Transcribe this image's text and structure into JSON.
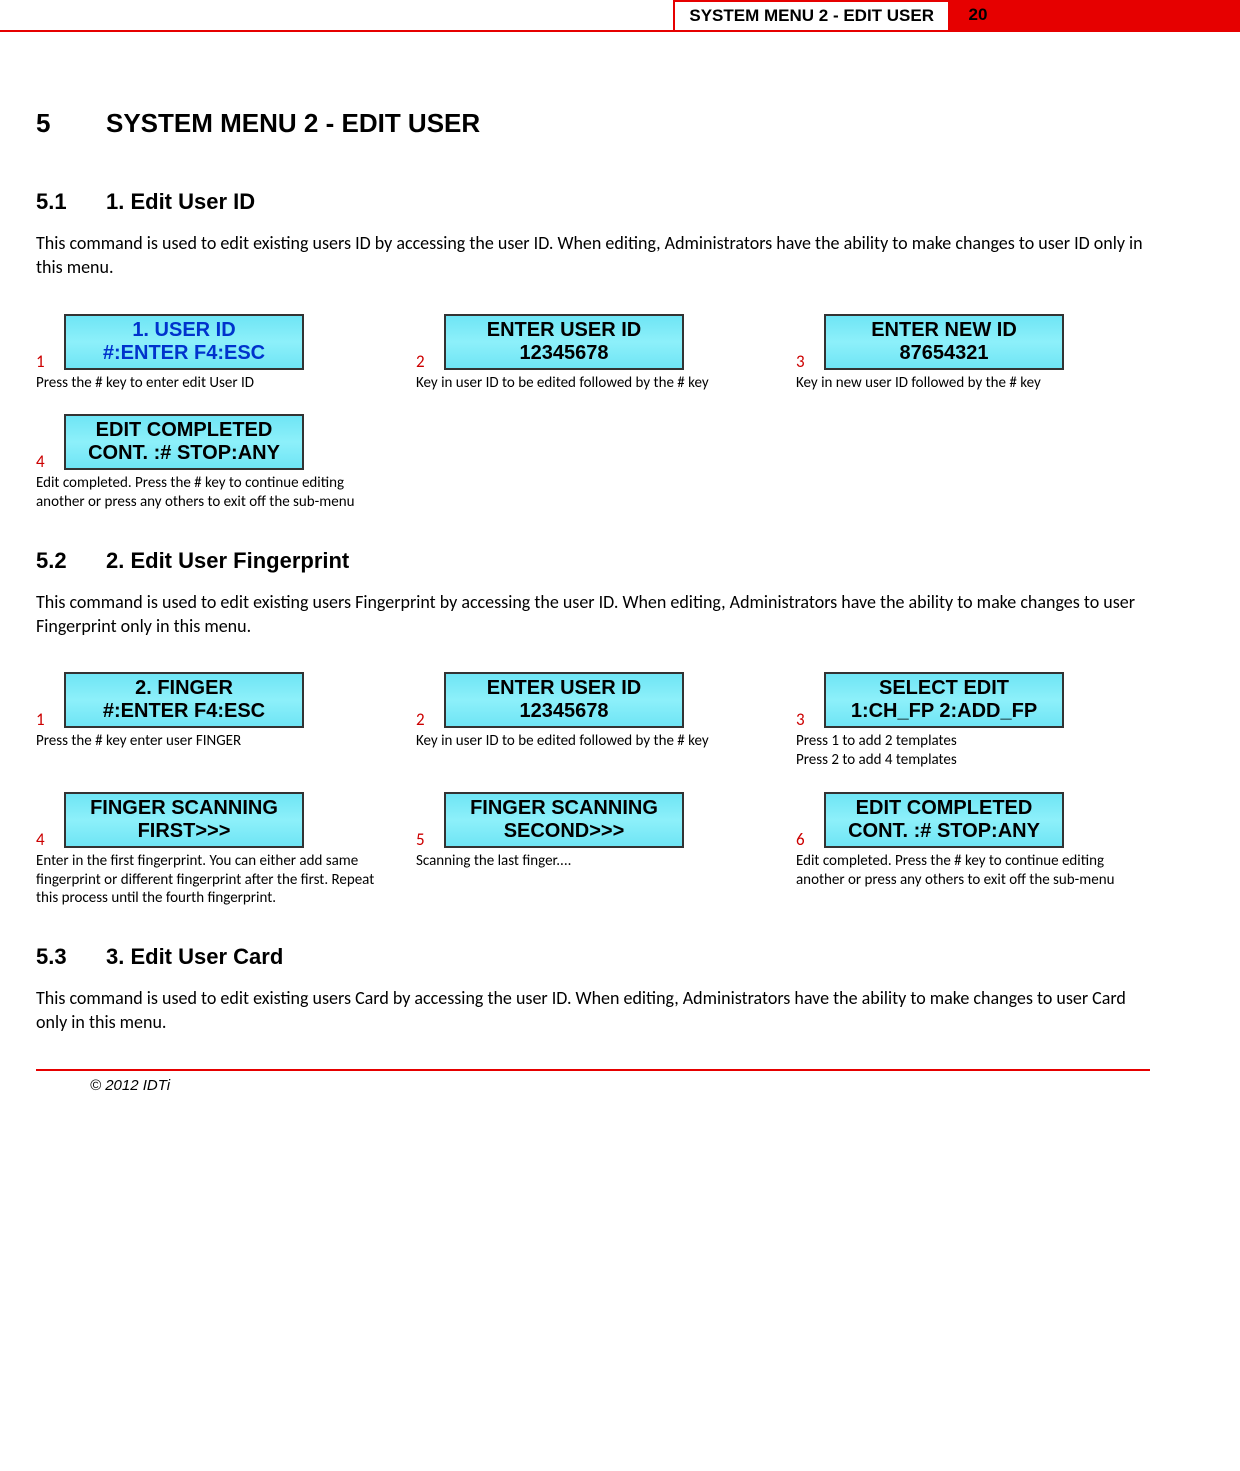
{
  "header": {
    "title": "SYSTEM MENU 2 - EDIT USER",
    "page_number": "20"
  },
  "section": {
    "number": "5",
    "title": "SYSTEM MENU 2 - EDIT USER"
  },
  "sub1": {
    "number": "5.1",
    "title": "1. Edit User ID",
    "body": "This command is used to edit existing users ID by accessing the user ID. When editing, Administrators have the ability to make changes to user ID only in this menu.",
    "steps": [
      {
        "num": "1",
        "lcd_line1": "1.  USER ID",
        "lcd_line2": "#:ENTER  F4:ESC",
        "blue": true,
        "caption": "Press the # key to enter edit User ID"
      },
      {
        "num": "2",
        "lcd_line1": "ENTER USER ID",
        "lcd_line2": "12345678",
        "blue": false,
        "caption": "Key in user ID to be edited followed by the # key"
      },
      {
        "num": "3",
        "lcd_line1": "ENTER NEW ID",
        "lcd_line2": "87654321",
        "blue": false,
        "caption": "Key in new user ID followed by the # key"
      },
      {
        "num": "4",
        "lcd_line1": "EDIT COMPLETED",
        "lcd_line2": "CONT. :# STOP:ANY",
        "blue": false,
        "caption": "Edit completed. Press the # key to continue editing another or press any others to exit off the sub-menu"
      }
    ]
  },
  "sub2": {
    "number": "5.2",
    "title": "2. Edit User Fingerprint",
    "body": "This command is used to edit existing users Fingerprint by accessing the user ID. When editing, Administrators have the ability to make changes to user Fingerprint only in this menu.",
    "steps": [
      {
        "num": "1",
        "lcd_line1": "2. FINGER",
        "lcd_line2": "#:ENTER   F4:ESC",
        "blue": false,
        "caption": "Press the # key enter user FINGER"
      },
      {
        "num": "2",
        "lcd_line1": "ENTER USER ID",
        "lcd_line2": "12345678",
        "blue": false,
        "caption": "Key in user ID to be edited followed by the # key"
      },
      {
        "num": "3",
        "lcd_line1": "SELECT EDIT",
        "lcd_line2": "1:CH_FP  2:ADD_FP",
        "blue": false,
        "caption": "Press 1 to add 2 templates\nPress 2 to add 4 templates"
      },
      {
        "num": "4",
        "lcd_line1": "FINGER SCANNING",
        "lcd_line2": "FIRST>>>",
        "blue": false,
        "caption": "Enter in the first fingerprint. You can either add same fingerprint or different fingerprint after the first. Repeat this process until the fourth fingerprint."
      },
      {
        "num": "5",
        "lcd_line1": "FINGER SCANNING",
        "lcd_line2": "SECOND>>>",
        "blue": false,
        "caption": "Scanning the last finger...."
      },
      {
        "num": "6",
        "lcd_line1": "EDIT COMPLETED",
        "lcd_line2": "CONT. :# STOP:ANY",
        "blue": false,
        "caption": "Edit completed. Press the # key to continue editing another or press any others to exit off the sub-menu"
      }
    ]
  },
  "sub3": {
    "number": "5.3",
    "title": "3. Edit User Card",
    "body": "This command is used to edit existing users Card by accessing the user ID. When editing, Administrators have the ability to make changes to user Card only in this menu."
  },
  "footer": {
    "copyright": "© 2012 IDTi"
  }
}
